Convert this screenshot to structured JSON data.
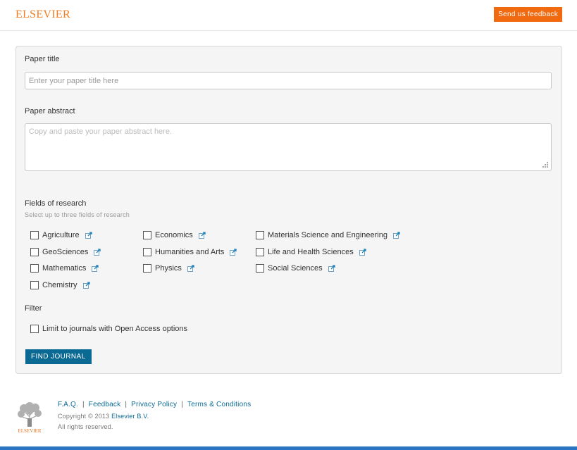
{
  "header": {
    "logo_text": "ELSEVIER",
    "feedback_label": "Send us feedback"
  },
  "form": {
    "title_label": "Paper title",
    "title_placeholder": "Enter your paper title here",
    "title_value": "",
    "abstract_label": "Paper abstract",
    "abstract_placeholder": "Copy and paste your paper abstract here.",
    "abstract_value": "",
    "fields_label": "Fields of research",
    "fields_hint": "Select up to three fields of research",
    "fields": [
      {
        "label": "Agriculture",
        "checked": false
      },
      {
        "label": "Economics",
        "checked": false
      },
      {
        "label": "Materials Science and Engineering",
        "checked": false
      },
      {
        "label": "GeoSciences",
        "checked": false
      },
      {
        "label": "Humanities and Arts",
        "checked": false
      },
      {
        "label": "Life and Health Sciences",
        "checked": false
      },
      {
        "label": "Mathematics",
        "checked": false
      },
      {
        "label": "Physics",
        "checked": false
      },
      {
        "label": "Social Sciences",
        "checked": false
      },
      {
        "label": "Chemistry",
        "checked": false
      }
    ],
    "filter_label": "Filter",
    "open_access_label": "Limit to journals with Open Access options",
    "open_access_checked": false,
    "find_button_label": "FIND JOURNAL"
  },
  "footer": {
    "logo_text": "ELSEVIER",
    "links": [
      "F.A.Q.",
      "Feedback",
      "Privacy Policy",
      "Terms & Conditions"
    ],
    "copyright_prefix": "Copyright © 2013",
    "copyright_link": "Elsevier B.V.",
    "rights": "All rights reserved."
  },
  "colors": {
    "brand_orange": "#f47c20",
    "feedback_button": "#f26a0f",
    "primary_button": "#0a6a94",
    "link": "#0a6a94",
    "bottom_bar": "#2b74c2"
  },
  "icons": {
    "external_link": "external-link-icon",
    "resize_grip": "resize-grip-icon",
    "checkbox": "checkbox-icon"
  }
}
